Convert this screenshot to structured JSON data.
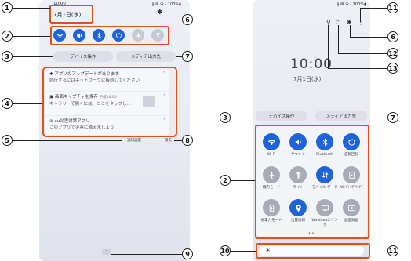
{
  "left": {
    "status_time": "10:00",
    "status_right": "∦ ⊠ 令 ᵢₗ 100%▮",
    "date": "7月1日(水)",
    "device_control": "デバイス操作",
    "media_output": "メディア出力先",
    "notifications": [
      {
        "title": "アプリのアップデートがあります",
        "sub": "続行するにはネットワークに接続してください"
      },
      {
        "title": "画面キャプチャを保存",
        "time": "午前10:00",
        "sub": "ギャラリーで開くには、ここをタップし..."
      },
      {
        "title": "au災害対策アプリ",
        "sub": "このアプリで災害に備えましょう"
      }
    ],
    "notification_settings": "通知設定",
    "clear": "消去"
  },
  "right": {
    "clock": "10:00",
    "date": "7月1日(水)",
    "device_control": "デバイス操作",
    "media_output": "メディア出力先",
    "tiles": [
      {
        "label": "Wi-Fi",
        "icon": "wifi-icon",
        "on": true
      },
      {
        "label": "サウンド",
        "icon": "sound-icon",
        "on": true
      },
      {
        "label": "Bluetooth",
        "icon": "bluetooth-icon",
        "on": true
      },
      {
        "label": "自動回転",
        "icon": "rotate-icon",
        "on": true
      },
      {
        "label": "機内モード",
        "icon": "airplane-icon",
        "on": false
      },
      {
        "label": "ライト",
        "icon": "flashlight-icon",
        "on": false
      },
      {
        "label": "モバイル データ",
        "icon": "mobile-data-icon",
        "on": true
      },
      {
        "label": "Wi-Fi ﾃｻﾞﾘﾝｸﾞ",
        "icon": "hotspot-icon",
        "on": false
      },
      {
        "label": "省電力モード",
        "icon": "battery-saver-icon",
        "on": false
      },
      {
        "label": "位置情報",
        "icon": "location-icon",
        "on": true
      },
      {
        "label": "Windowsにリンク",
        "icon": "link-windows-icon",
        "on": false
      },
      {
        "label": "画面録画",
        "icon": "screen-record-icon",
        "on": false
      }
    ]
  },
  "callouts": [
    "1",
    "2",
    "3",
    "4",
    "5",
    "6",
    "7",
    "8",
    "9",
    "10",
    "11",
    "12",
    "13"
  ],
  "colors": {
    "accent": "#1e63d8",
    "marker": "#e0501a"
  }
}
